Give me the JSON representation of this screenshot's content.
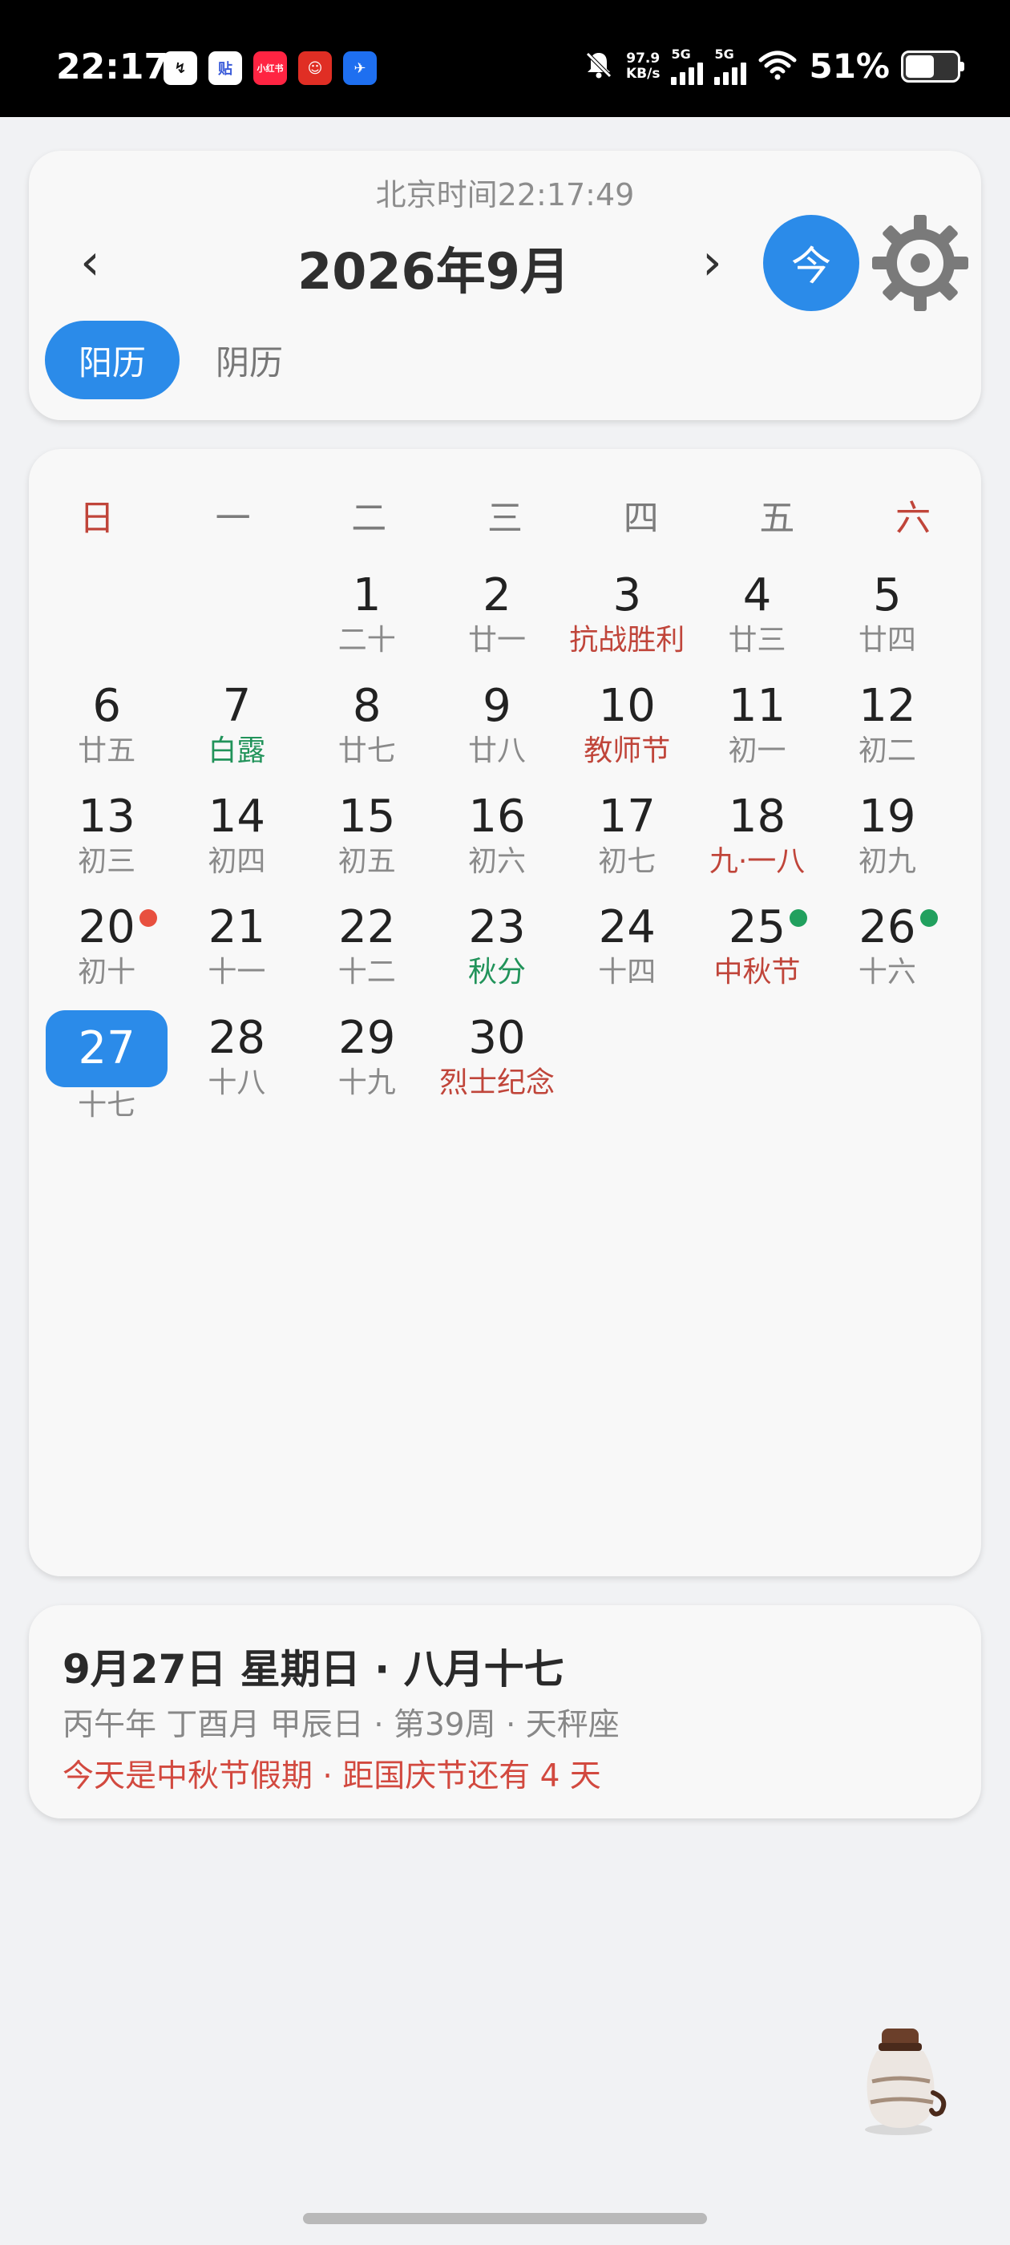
{
  "status_bar": {
    "time": "22:17",
    "apps": [
      {
        "icon": "swap-app-icon",
        "glyph": "↯",
        "bg": "#ffffff",
        "fg": "#111111"
      },
      {
        "icon": "tieba-app-icon",
        "glyph": "贴",
        "bg": "#ffffff",
        "fg": "#3a5bd9"
      },
      {
        "icon": "xiaohongshu-app-icon",
        "glyph": "小红书",
        "bg": "#ff2442",
        "fg": "#ffffff"
      },
      {
        "icon": "pinduoduo-app-icon",
        "glyph": "☺",
        "bg": "#e02e24",
        "fg": "#ffffff"
      },
      {
        "icon": "feizhu-app-icon",
        "glyph": "✈",
        "bg": "#1e6ff0",
        "fg": "#ffffff"
      }
    ],
    "speed_value": "97.9",
    "speed_unit": "KB/s",
    "signal_1_label": "5G",
    "signal_2_label": "5G",
    "battery_text": "51%",
    "battery_level": 0.51
  },
  "header": {
    "beijing_time": "北京时间22:17:49",
    "month_title": "2026年9月",
    "prev_symbol": "‹",
    "next_symbol": "›",
    "today_label": "今",
    "segments": {
      "solar": "阳历",
      "lunar": "阴历"
    }
  },
  "calendar": {
    "weekdays": [
      "日",
      "一",
      "二",
      "三",
      "四",
      "五",
      "六"
    ],
    "leading_blanks": 2,
    "days": [
      {
        "day": "1",
        "sub": "二十",
        "type": "lunar"
      },
      {
        "day": "2",
        "sub": "廿一",
        "type": "lunar"
      },
      {
        "day": "3",
        "sub": "抗战胜利",
        "type": "holiday"
      },
      {
        "day": "4",
        "sub": "廿三",
        "type": "lunar"
      },
      {
        "day": "5",
        "sub": "廿四",
        "type": "lunar"
      },
      {
        "day": "6",
        "sub": "廿五",
        "type": "lunar"
      },
      {
        "day": "7",
        "sub": "白露",
        "type": "term"
      },
      {
        "day": "8",
        "sub": "廿七",
        "type": "lunar"
      },
      {
        "day": "9",
        "sub": "廿八",
        "type": "lunar"
      },
      {
        "day": "10",
        "sub": "教师节",
        "type": "holiday"
      },
      {
        "day": "11",
        "sub": "初一",
        "type": "lunar"
      },
      {
        "day": "12",
        "sub": "初二",
        "type": "lunar"
      },
      {
        "day": "13",
        "sub": "初三",
        "type": "lunar"
      },
      {
        "day": "14",
        "sub": "初四",
        "type": "lunar"
      },
      {
        "day": "15",
        "sub": "初五",
        "type": "lunar"
      },
      {
        "day": "16",
        "sub": "初六",
        "type": "lunar"
      },
      {
        "day": "17",
        "sub": "初七",
        "type": "lunar"
      },
      {
        "day": "18",
        "sub": "九·一八",
        "type": "holiday"
      },
      {
        "day": "19",
        "sub": "初九",
        "type": "lunar"
      },
      {
        "day": "20",
        "sub": "初十",
        "type": "lunar",
        "dot": "red"
      },
      {
        "day": "21",
        "sub": "十一",
        "type": "lunar"
      },
      {
        "day": "22",
        "sub": "十二",
        "type": "lunar"
      },
      {
        "day": "23",
        "sub": "秋分",
        "type": "term"
      },
      {
        "day": "24",
        "sub": "十四",
        "type": "lunar"
      },
      {
        "day": "25",
        "sub": "中秋节",
        "type": "holiday",
        "dot": "green"
      },
      {
        "day": "26",
        "sub": "十六",
        "type": "lunar",
        "dot": "green"
      },
      {
        "day": "27",
        "sub": "十七",
        "type": "lunar",
        "selected": true
      },
      {
        "day": "28",
        "sub": "十八",
        "type": "lunar"
      },
      {
        "day": "29",
        "sub": "十九",
        "type": "lunar"
      },
      {
        "day": "30",
        "sub": "烈士纪念",
        "type": "holiday"
      }
    ],
    "dot_colors": {
      "red": "#e8503f",
      "green": "#21a05e"
    }
  },
  "info": {
    "date_line": "9月27日 星期日 · 八月十七",
    "ganzhi_line": "丙午年 丁酉月 甲辰日 · 第39周 · 天秤座",
    "holiday_line": "今天是中秋节假期 · 距国庆节还有 4 天"
  },
  "colors": {
    "accent": "#2b8be9",
    "weekend_red": "#c0453a",
    "term_green": "#21935a",
    "holiday_red": "#d2493f"
  }
}
